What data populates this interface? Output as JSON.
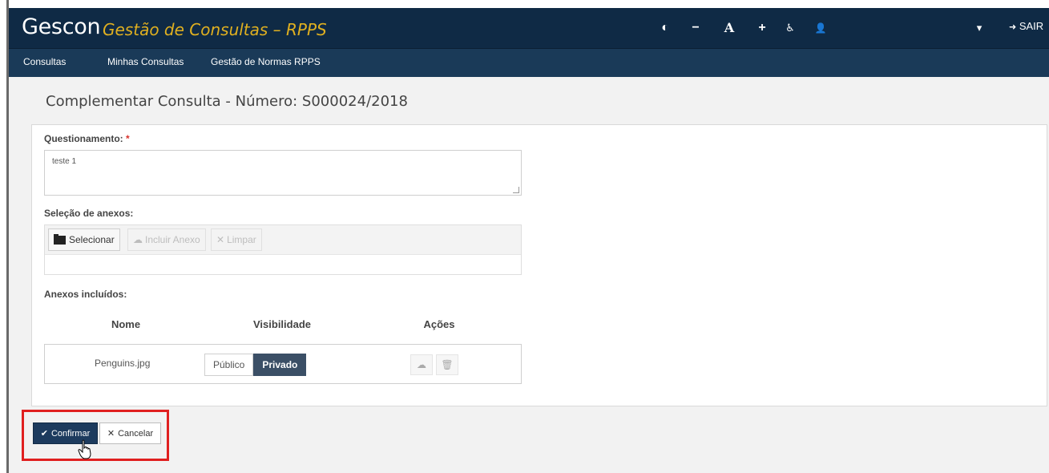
{
  "header": {
    "brand": "Gescon",
    "subtitle": "Gestão de Consultas – RPPS",
    "toolbar_icons": [
      {
        "name": "contrast-icon",
        "glyph": "◐"
      },
      {
        "name": "font-decrease-icon",
        "glyph": "−"
      },
      {
        "name": "font-reset-icon",
        "glyph": "A"
      },
      {
        "name": "font-increase-icon",
        "glyph": "+"
      },
      {
        "name": "accessibility-icon",
        "glyph": "♿"
      },
      {
        "name": "user-icon",
        "glyph": "👤"
      },
      {
        "name": "user-menu-caret-icon",
        "glyph": "▾"
      }
    ],
    "logout_label": "SAIR"
  },
  "nav": {
    "items": [
      "Consultas",
      "Minhas Consultas",
      "Gestão de Normas RPPS"
    ]
  },
  "page": {
    "title": "Complementar Consulta - Número: S000024/2018"
  },
  "form": {
    "questionamento_label": "Questionamento:",
    "required_marker": "*",
    "questionamento_value": "teste 1",
    "anexos_label": "Seleção de anexos:",
    "select_button": "Selecionar",
    "include_button": "Incluir Anexo",
    "clear_button": "Limpar",
    "included_label": "Anexos incluídos:"
  },
  "table": {
    "headers": [
      "Nome",
      "Visibilidade",
      "Ações"
    ],
    "rows": [
      {
        "name": "Penguins.jpg",
        "public_label": "Público",
        "private_label": "Privado",
        "selected": "Privado"
      }
    ]
  },
  "actions": {
    "confirm": "Confirmar",
    "cancel": "Cancelar"
  },
  "colors": {
    "header_bg": "#0f2a45",
    "brand_accent": "#e0b020",
    "highlight": "#e02020",
    "primary_button": "#1d3b5e"
  }
}
